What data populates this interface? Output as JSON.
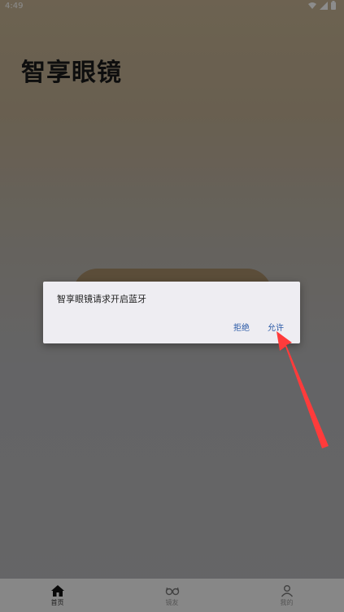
{
  "status_bar": {
    "time": "4:49",
    "icons": [
      "wifi-icon",
      "signal-icon",
      "battery-icon"
    ]
  },
  "header": {
    "title": "智享眼镜"
  },
  "dialog": {
    "message": "智享眼镜请求开启蓝牙",
    "deny_label": "拒绝",
    "allow_label": "允许"
  },
  "tabs": [
    {
      "label": "首页",
      "icon": "home-icon"
    },
    {
      "label": "镜友",
      "icon": "glasses-icon"
    },
    {
      "label": "我的",
      "icon": "user-icon"
    }
  ],
  "colors": {
    "accent": "#2b5aa7",
    "arrow": "#ff3b3b",
    "title": "#1b1b1b"
  }
}
